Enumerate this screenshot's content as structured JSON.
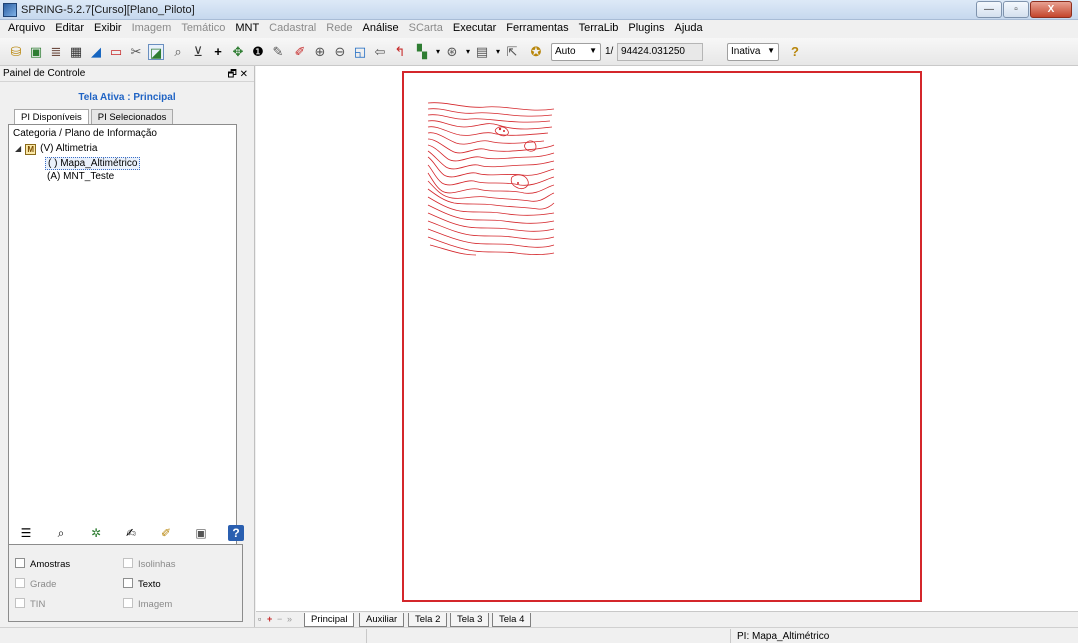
{
  "window": {
    "title": "SPRING-5.2.7[Curso][Plano_Piloto]",
    "minimize": "—",
    "maximize": "▫",
    "close": "X"
  },
  "menu": [
    {
      "label": "Arquivo",
      "enabled": true
    },
    {
      "label": "Editar",
      "enabled": true
    },
    {
      "label": "Exibir",
      "enabled": true
    },
    {
      "label": "Imagem",
      "enabled": false
    },
    {
      "label": "Temático",
      "enabled": false
    },
    {
      "label": "MNT",
      "enabled": true
    },
    {
      "label": "Cadastral",
      "enabled": false
    },
    {
      "label": "Rede",
      "enabled": false
    },
    {
      "label": "Análise",
      "enabled": true
    },
    {
      "label": "SCarta",
      "enabled": false
    },
    {
      "label": "Executar",
      "enabled": true
    },
    {
      "label": "Ferramentas",
      "enabled": true
    },
    {
      "label": "TerraLib",
      "enabled": true
    },
    {
      "label": "Plugins",
      "enabled": true
    },
    {
      "label": "Ajuda",
      "enabled": true
    }
  ],
  "toolbar": {
    "scale_mode": "Auto",
    "scale_prefix": "1/",
    "scale_value": "94424.031250",
    "status_select": "Inativa"
  },
  "panel": {
    "title": "Painel de Controle",
    "active_screen": "Tela Ativa : Principal",
    "tabs": [
      "PI Disponíveis",
      "PI Selecionados"
    ],
    "tree_header": "Categoria / Plano de Informação",
    "category": "(V) Altimetria",
    "category_badge": "M",
    "items": [
      "( ) Mapa_Altimétrico",
      "(A) MNT_Teste"
    ],
    "checkboxes": [
      {
        "label": "Amostras",
        "enabled": true
      },
      {
        "label": "Isolinhas",
        "enabled": false
      },
      {
        "label": "Grade",
        "enabled": false
      },
      {
        "label": "Texto",
        "enabled": true
      },
      {
        "label": "TIN",
        "enabled": false
      },
      {
        "label": "Imagem",
        "enabled": false
      }
    ]
  },
  "screen_tabs": [
    "Principal",
    "Auxiliar",
    "Tela 2",
    "Tela 3",
    "Tela 4"
  ],
  "status": {
    "pi": "PI: Mapa_Altimétrico"
  },
  "colors": {
    "frame": "#d4262b",
    "contours": "#d4262b",
    "active_label": "#1f63c4"
  }
}
